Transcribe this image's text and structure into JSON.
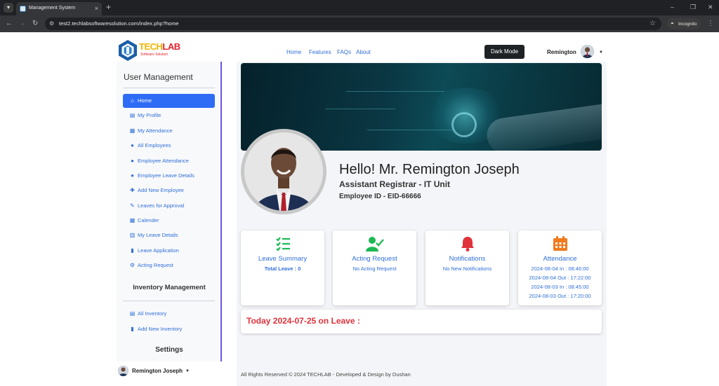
{
  "browser": {
    "tab_title": "Management System",
    "tab_close": "×",
    "new_tab": "+",
    "url": "test2.techlabsoftwaresolution.com/index.php?home",
    "incognito_label": "Incognito",
    "window_minimize": "–",
    "window_restore": "❐",
    "window_close": "✕"
  },
  "navbar": {
    "logo_text_1": "TECH",
    "logo_text_2": "LAB",
    "logo_sub": "Software Solution",
    "links": [
      "Home",
      "Features",
      "FAQs",
      "About"
    ],
    "dark_mode_label": "Dark Mode",
    "user_name": "Remington"
  },
  "sidebar": {
    "heading": "User Management",
    "items": [
      {
        "label": "Home",
        "icon": "home-icon",
        "active": true
      },
      {
        "label": "My Profile",
        "icon": "id-card-icon"
      },
      {
        "label": "My Attendance",
        "icon": "calendar-icon"
      },
      {
        "label": "All Employees",
        "icon": "user-icon"
      },
      {
        "label": "Employee Attendance",
        "icon": "user-icon"
      },
      {
        "label": "Employee Leave Details",
        "icon": "user-icon"
      },
      {
        "label": "Add New Employee",
        "icon": "user-plus-icon"
      },
      {
        "label": "Leaves for Approval",
        "icon": "edit-icon"
      },
      {
        "label": "Calender",
        "icon": "calendar-grid-icon"
      },
      {
        "label": "My Leave Details",
        "icon": "table-icon"
      },
      {
        "label": "Leave Application",
        "icon": "file-icon"
      },
      {
        "label": "Acting Request",
        "icon": "user-gear-icon"
      }
    ],
    "inventory_heading": "Inventory Management",
    "inventory_items": [
      {
        "label": "All Inventory",
        "icon": "building-icon"
      },
      {
        "label": "Add New Inventory",
        "icon": "file-plus-icon"
      }
    ],
    "settings_heading": "Settings",
    "user_name": "Remington Joseph"
  },
  "profile": {
    "greeting": "Hello! Mr. Remington Joseph",
    "role": "Assistant Registrar - IT Unit",
    "employee_id": "Employee ID - EID-66666"
  },
  "cards": [
    {
      "title": "Leave Summary",
      "icon": "checklist-icon",
      "icon_color": "#1db954",
      "lines": [
        "Total Leave : 0"
      ]
    },
    {
      "title": "Acting Request",
      "icon": "user-check-icon",
      "icon_color": "#1db954",
      "lines": [
        "No Acting Request"
      ]
    },
    {
      "title": "Notifications",
      "icon": "bell-icon",
      "icon_color": "#e0323a",
      "lines": [
        "No New Notifications"
      ]
    },
    {
      "title": "Attendance",
      "icon": "calendar-icon",
      "icon_color": "#f07b1d",
      "lines": [
        "2024-08-04 In : 08:46:00",
        "2024-08-04 Out : 17:22:00",
        "2024-08-03 In : 08:45:00",
        "2024-08-03 Out : 17:20:00"
      ]
    }
  ],
  "today": "Today 2024-07-25 on Leave :",
  "footer": "All Rights Reserved © 2024 TECHLAB - Developed & Design by Dushan",
  "colors": {
    "accent": "#2f6cf6",
    "link": "#2f6fd6",
    "danger": "#e0323a",
    "sidebar_border": "#6f55e0"
  }
}
